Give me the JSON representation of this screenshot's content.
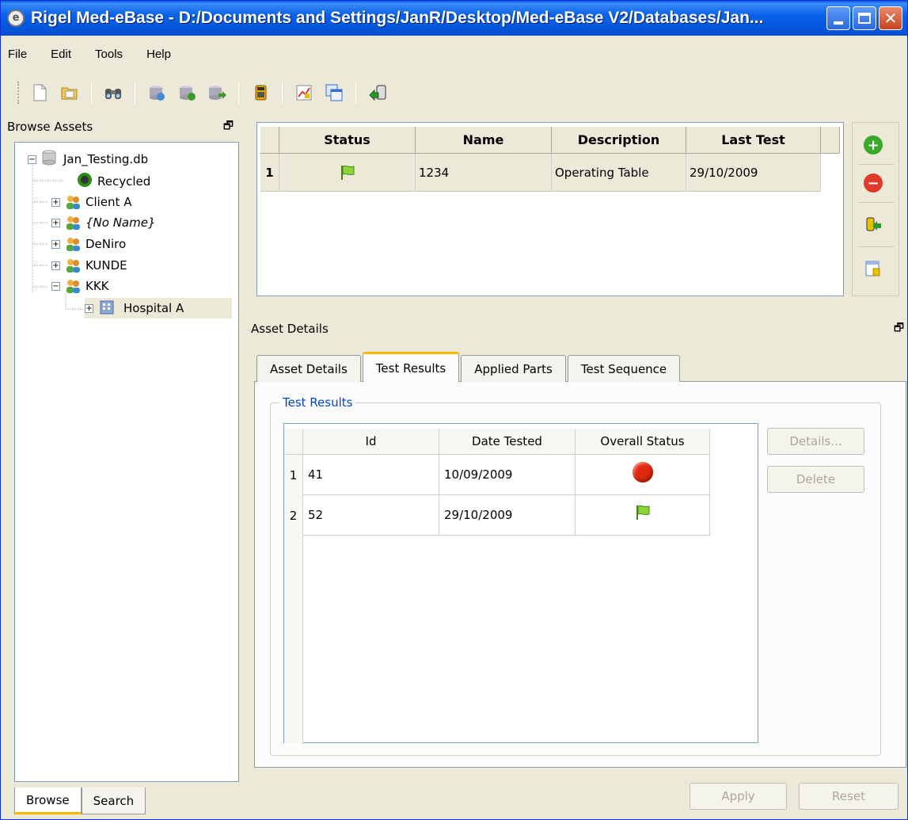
{
  "window": {
    "title": "Rigel Med-eBase - D:/Documents and Settings/JanR/Desktop/Med-eBase V2/Databases/Jan..."
  },
  "menu": [
    "File",
    "Edit",
    "Tools",
    "Help"
  ],
  "browse_panel": {
    "title": "Browse Assets",
    "tree": [
      {
        "label": "Jan_Testing.db",
        "type": "database"
      },
      {
        "label": "Recycled",
        "type": "recycle"
      },
      {
        "label": "Client A",
        "type": "client"
      },
      {
        "label": "{No Name}",
        "type": "client"
      },
      {
        "label": "DeNiro",
        "type": "client"
      },
      {
        "label": "KUNDE",
        "type": "client"
      },
      {
        "label": "KKK",
        "type": "client"
      },
      {
        "label": "Hospital A",
        "type": "building"
      }
    ],
    "tabs": [
      "Browse",
      "Search"
    ]
  },
  "assets_grid": {
    "columns": [
      "Status",
      "Name",
      "Description",
      "Last Test"
    ],
    "rows": [
      {
        "num": "1",
        "status_icon": "green-flag-icon",
        "name": "1234",
        "description": "Operating Table",
        "last_test": "29/10/2009"
      }
    ]
  },
  "asset_details": {
    "title": "Asset Details",
    "tabs": [
      "Asset Details",
      "Test Results",
      "Applied Parts",
      "Test Sequence"
    ],
    "active_tab": "Test Results",
    "group_title": "Test Results",
    "columns": [
      "Id",
      "Date Tested",
      "Overall Status"
    ],
    "rows": [
      {
        "num": "1",
        "id": "41",
        "date": "10/09/2009",
        "status_icon": "red-stop-icon"
      },
      {
        "num": "2",
        "id": "52",
        "date": "29/10/2009",
        "status_icon": "green-flag-icon"
      }
    ],
    "buttons": {
      "details": "Details...",
      "delete": "Delete"
    }
  },
  "footer_buttons": {
    "apply": "Apply",
    "reset": "Reset"
  }
}
